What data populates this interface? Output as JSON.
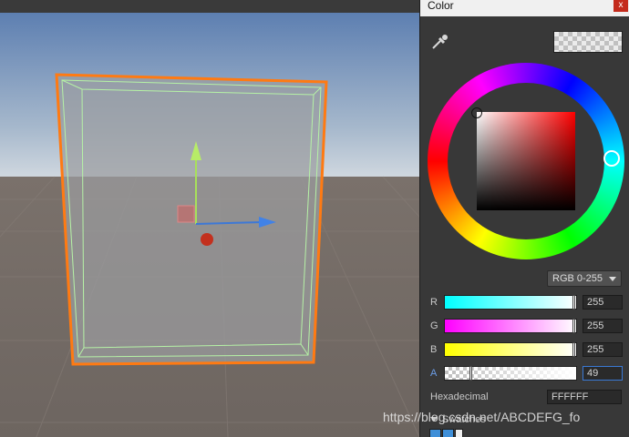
{
  "window": {
    "title": "Color",
    "close_label": "x"
  },
  "icons": {
    "eyedropper": "eyedropper-icon",
    "close": "close-icon",
    "dropdown": "chevron-down-icon",
    "foldout": "triangle-down-icon"
  },
  "picker": {
    "current_color": "#FFFFFF",
    "alpha_value": 49,
    "mode": "RGB 0-255"
  },
  "channels": [
    {
      "label": "R",
      "value": "255"
    },
    {
      "label": "G",
      "value": "255"
    },
    {
      "label": "B",
      "value": "255"
    },
    {
      "label": "A",
      "value": "49"
    }
  ],
  "hex": {
    "label": "Hexadecimal",
    "value": "FFFFFF"
  },
  "swatches": {
    "label": "Swatches"
  },
  "watermark": "https://blog.csdn.net/ABCDEFG_fo"
}
